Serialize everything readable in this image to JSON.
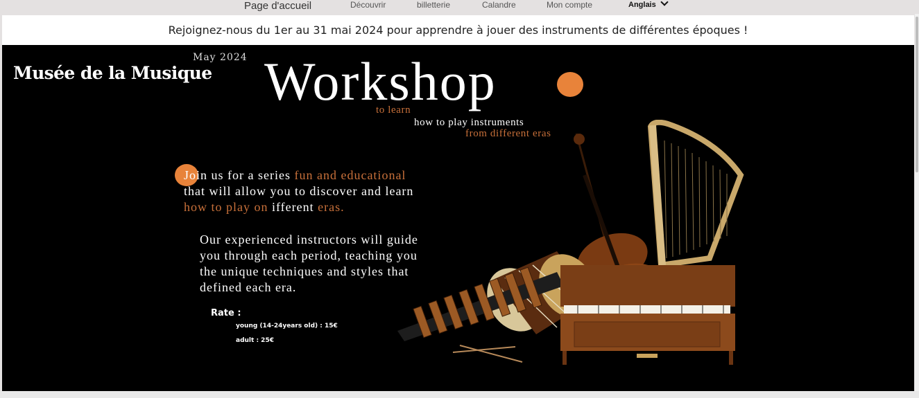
{
  "nav": {
    "home": "Page d'accueil",
    "items": [
      "Découvrir",
      "billetterie",
      "Calandre",
      "Mon compte"
    ],
    "language": "Anglais"
  },
  "banner": {
    "text": "Rejoignez-nous du 1er au 31 mai 2024 pour apprendre à jouer des instruments de différentes époques !"
  },
  "hero": {
    "museum_title": "Musée de la Musique",
    "date": "May 2024",
    "title": "Workshop",
    "subtitle": {
      "line1": "to learn",
      "line2": "how to play instruments",
      "line3": "from different eras"
    },
    "intro": {
      "l1a": "Join us for a series ",
      "l1b": "fun and educational",
      "l2": "that will allow you to discover and learn",
      "l3a": "how to play on ",
      "l3b": "ifferent ",
      "l3c": "eras."
    },
    "body": [
      "Our experienced instructors will guide",
      "you through each period, teaching you",
      "the unique techniques and styles that",
      "defined each era."
    ],
    "rate": {
      "label": "Rate :",
      "young": "young (14-24years old) : 15€",
      "adult": "adult : 25€"
    },
    "accent_color": "#e8833a"
  }
}
